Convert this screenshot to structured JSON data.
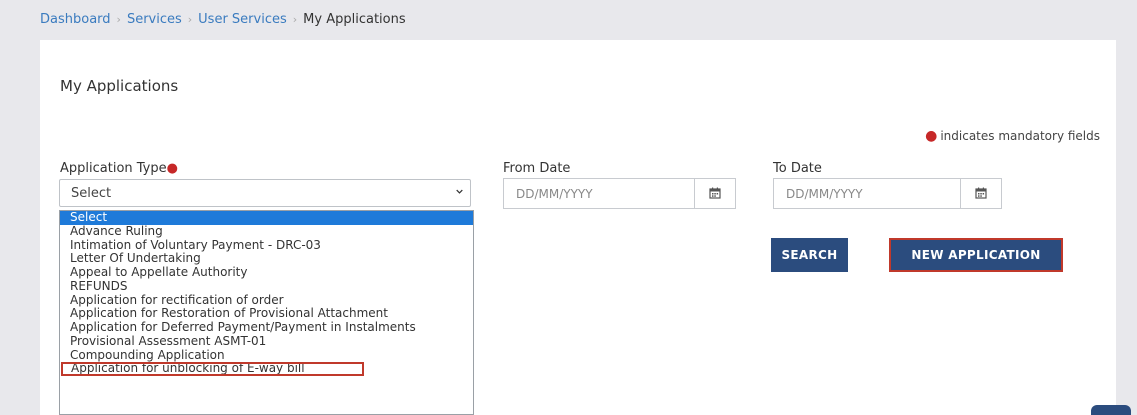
{
  "breadcrumb": {
    "items": [
      "Dashboard",
      "Services",
      "User Services"
    ],
    "current": "My Applications"
  },
  "page_title": "My Applications",
  "mandatory_note": "indicates mandatory fields",
  "form": {
    "application_type_label": "Application Type",
    "application_type_value": "Select",
    "from_date_label": "From Date",
    "from_date_placeholder": "DD/MM/YYYY",
    "to_date_label": "To Date",
    "to_date_placeholder": "DD/MM/YYYY"
  },
  "dropdown_options": [
    "Select",
    "Advance Ruling",
    "Intimation of Voluntary Payment - DRC-03",
    "Letter Of Undertaking",
    "Appeal to Appellate Authority",
    "REFUNDS",
    "Application for rectification of order",
    "Application for Restoration of Provisional Attachment",
    "Application for Deferred Payment/Payment in Instalments",
    "Provisional Assessment ASMT-01",
    "Compounding Application",
    "Application for unblocking of E-way bill"
  ],
  "buttons": {
    "search": "SEARCH",
    "new_application": "NEW APPLICATION"
  },
  "icons": {
    "calendar": "calendar-icon",
    "chevron": "chevron-down-icon"
  },
  "colors": {
    "primary_button": "#2b4c7e",
    "link": "#3a7bbf",
    "required": "#c62828",
    "selected_option": "#1e7ad9",
    "highlight_outline": "#c0392b"
  }
}
